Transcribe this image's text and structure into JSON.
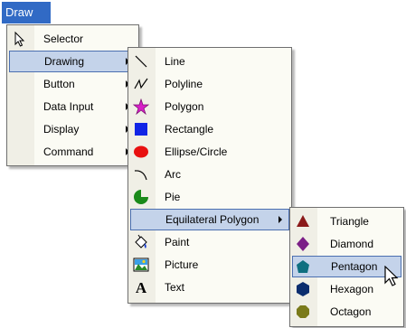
{
  "menubar": {
    "draw": "Draw"
  },
  "main_menu": {
    "items": [
      {
        "label": "Selector",
        "icon": "pointer-icon"
      },
      {
        "label": "Drawing"
      },
      {
        "label": "Button"
      },
      {
        "label": "Data Input"
      },
      {
        "label": "Display"
      },
      {
        "label": "Command"
      }
    ]
  },
  "drawing_menu": {
    "items": [
      {
        "label": "Line",
        "icon": "line-icon"
      },
      {
        "label": "Polyline",
        "icon": "polyline-icon"
      },
      {
        "label": "Polygon",
        "icon": "polygon-icon"
      },
      {
        "label": "Rectangle",
        "icon": "rectangle-icon"
      },
      {
        "label": "Ellipse/Circle",
        "icon": "ellipse-icon"
      },
      {
        "label": "Arc",
        "icon": "arc-icon"
      },
      {
        "label": "Pie",
        "icon": "pie-icon"
      },
      {
        "label": "Equilateral Polygon"
      },
      {
        "label": "Paint",
        "icon": "paint-bucket-icon"
      },
      {
        "label": "Picture",
        "icon": "picture-icon"
      },
      {
        "label": "Text",
        "icon": "text-icon"
      }
    ]
  },
  "polygon_menu": {
    "items": [
      {
        "label": "Triangle",
        "icon": "triangle-icon"
      },
      {
        "label": "Diamond",
        "icon": "diamond-icon"
      },
      {
        "label": "Pentagon",
        "icon": "pentagon-icon"
      },
      {
        "label": "Hexagon",
        "icon": "hexagon-icon"
      },
      {
        "label": "Octagon",
        "icon": "octagon-icon"
      }
    ]
  },
  "colors": {
    "highlight": "#316ac5",
    "hover_fill": "#c4d3ea",
    "menu_bg": "#fbfbf4",
    "triangle": "#8b1a1a",
    "diamond": "#7b1f87",
    "pentagon": "#0f6f80",
    "hexagon": "#0b2d6e",
    "octagon": "#7a7a1a"
  }
}
